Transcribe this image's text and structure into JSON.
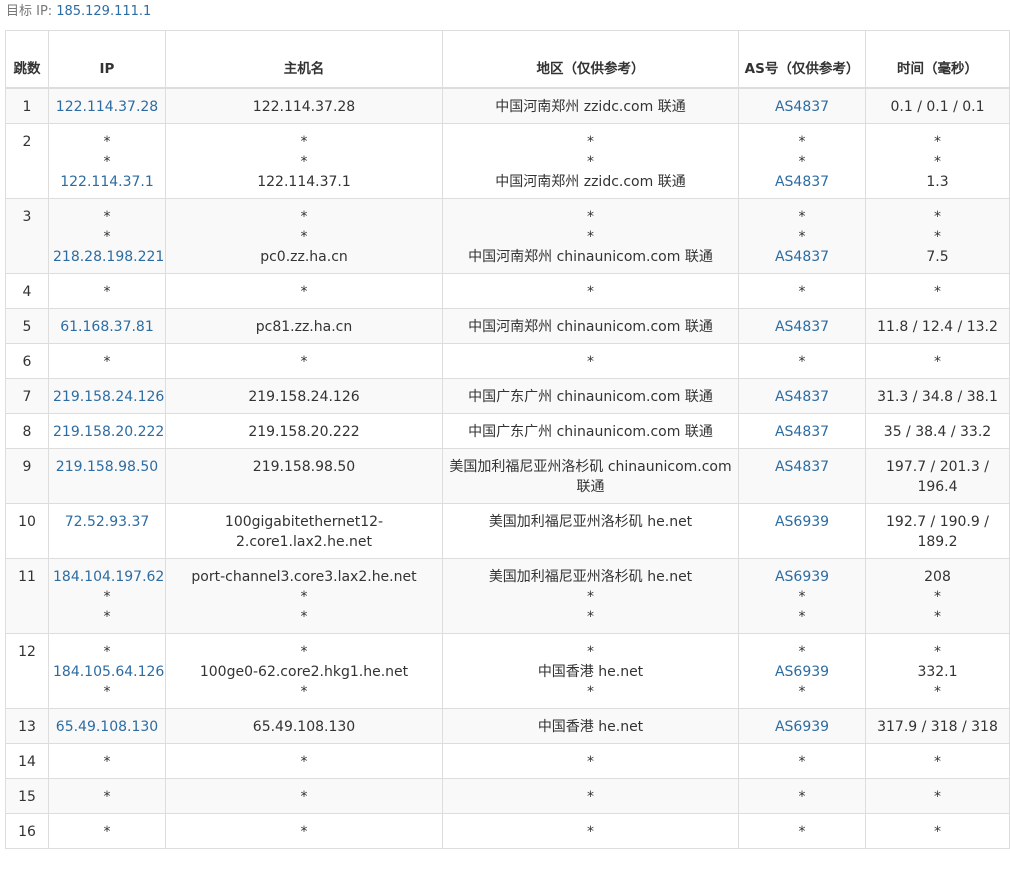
{
  "target": {
    "label": "目标 IP:",
    "ip": "185.129.111.1"
  },
  "headers": {
    "hop": "跳数",
    "ip": "IP",
    "host": "主机名",
    "region": "地区（仅供参考）",
    "as": "AS号（仅供参考）",
    "time": "时间（毫秒）"
  },
  "rows": [
    {
      "hop": "1",
      "ip": [
        "122.114.37.28"
      ],
      "host": [
        "122.114.37.28"
      ],
      "region": [
        "中国河南郑州 zzidc.com 联通"
      ],
      "as": [
        "AS4837"
      ],
      "time": [
        "0.1 / 0.1 / 0.1"
      ]
    },
    {
      "hop": "2",
      "ip": [
        "*",
        "*",
        "122.114.37.1"
      ],
      "host": [
        "*",
        "*",
        "122.114.37.1"
      ],
      "region": [
        "*",
        "*",
        "中国河南郑州 zzidc.com 联通"
      ],
      "as": [
        "*",
        "*",
        "AS4837"
      ],
      "time": [
        "*",
        "*",
        "1.3"
      ]
    },
    {
      "hop": "3",
      "ip": [
        "*",
        "*",
        "218.28.198.221"
      ],
      "host": [
        "*",
        "*",
        "pc0.zz.ha.cn"
      ],
      "region": [
        "*",
        "*",
        "中国河南郑州 chinaunicom.com 联通"
      ],
      "as": [
        "*",
        "*",
        "AS4837"
      ],
      "time": [
        "*",
        "*",
        "7.5"
      ]
    },
    {
      "hop": "4",
      "ip": [
        "*"
      ],
      "host": [
        "*"
      ],
      "region": [
        "*"
      ],
      "as": [
        "*"
      ],
      "time": [
        "*"
      ]
    },
    {
      "hop": "5",
      "ip": [
        "61.168.37.81"
      ],
      "host": [
        "pc81.zz.ha.cn"
      ],
      "region": [
        "中国河南郑州 chinaunicom.com 联通"
      ],
      "as": [
        "AS4837"
      ],
      "time": [
        "11.8 / 12.4 / 13.2"
      ]
    },
    {
      "hop": "6",
      "ip": [
        "*"
      ],
      "host": [
        "*"
      ],
      "region": [
        "*"
      ],
      "as": [
        "*"
      ],
      "time": [
        "*"
      ]
    },
    {
      "hop": "7",
      "ip": [
        "219.158.24.126"
      ],
      "host": [
        "219.158.24.126"
      ],
      "region": [
        "中国广东广州 chinaunicom.com 联通"
      ],
      "as": [
        "AS4837"
      ],
      "time": [
        "31.3 / 34.8 / 38.1"
      ]
    },
    {
      "hop": "8",
      "ip": [
        "219.158.20.222"
      ],
      "host": [
        "219.158.20.222"
      ],
      "region": [
        "中国广东广州 chinaunicom.com 联通"
      ],
      "as": [
        "AS4837"
      ],
      "time": [
        "35 / 38.4 / 33.2"
      ]
    },
    {
      "hop": "9",
      "ip": [
        "219.158.98.50"
      ],
      "host": [
        "219.158.98.50"
      ],
      "region": [
        "美国加利福尼亚州洛杉矶 chinaunicom.com 联通"
      ],
      "as": [
        "AS4837"
      ],
      "time": [
        "197.7 / 201.3 / 196.4"
      ]
    },
    {
      "hop": "10",
      "ip": [
        "72.52.93.37"
      ],
      "host": [
        "100gigabitethernet12-2.core1.lax2.he.net"
      ],
      "region": [
        "美国加利福尼亚州洛杉矶 he.net"
      ],
      "as": [
        "AS6939"
      ],
      "time": [
        "192.7 / 190.9 / 189.2"
      ]
    },
    {
      "hop": "11",
      "ip": [
        "184.104.197.62",
        "*",
        "*"
      ],
      "host": [
        "port-channel3.core3.lax2.he.net",
        "*",
        "*"
      ],
      "region": [
        "美国加利福尼亚州洛杉矶 he.net",
        "*",
        "*"
      ],
      "as": [
        "AS6939",
        "*",
        "*"
      ],
      "time": [
        "208",
        "*",
        "*"
      ]
    },
    {
      "hop": "12",
      "ip": [
        "*",
        "184.105.64.126",
        "*"
      ],
      "host": [
        "*",
        "100ge0-62.core2.hkg1.he.net",
        "*"
      ],
      "region": [
        "*",
        "中国香港 he.net",
        "*"
      ],
      "as": [
        "*",
        "AS6939",
        "*"
      ],
      "time": [
        "*",
        "332.1",
        "*"
      ]
    },
    {
      "hop": "13",
      "ip": [
        "65.49.108.130"
      ],
      "host": [
        "65.49.108.130"
      ],
      "region": [
        "中国香港 he.net"
      ],
      "as": [
        "AS6939"
      ],
      "time": [
        "317.9 / 318 / 318"
      ]
    },
    {
      "hop": "14",
      "ip": [
        "*"
      ],
      "host": [
        "*"
      ],
      "region": [
        "*"
      ],
      "as": [
        "*"
      ],
      "time": [
        "*"
      ]
    },
    {
      "hop": "15",
      "ip": [
        "*"
      ],
      "host": [
        "*"
      ],
      "region": [
        "*"
      ],
      "as": [
        "*"
      ],
      "time": [
        "*"
      ]
    },
    {
      "hop": "16",
      "ip": [
        "*"
      ],
      "host": [
        "*"
      ],
      "region": [
        "*"
      ],
      "as": [
        "*"
      ],
      "time": [
        "*"
      ]
    }
  ]
}
